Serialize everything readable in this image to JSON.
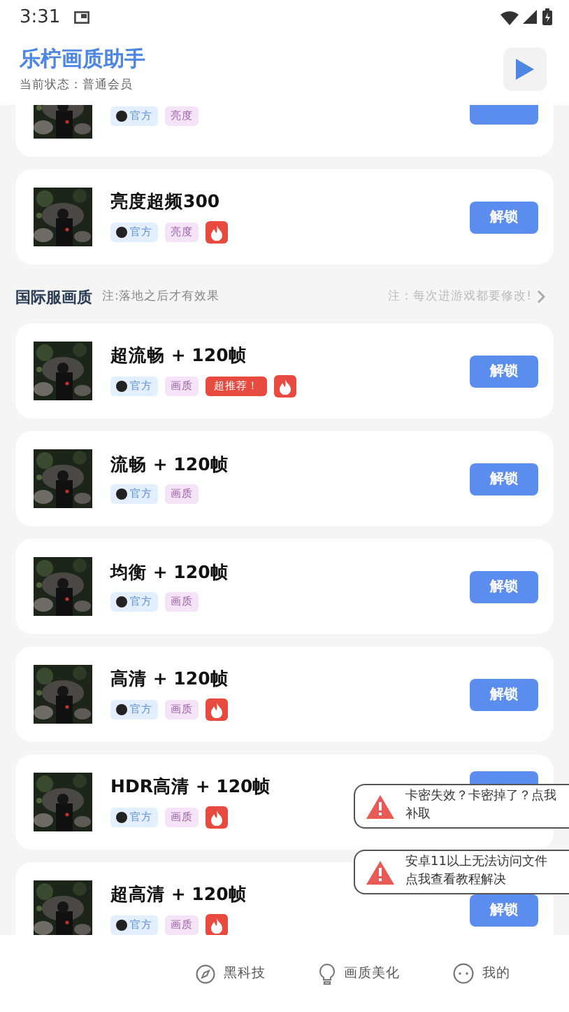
{
  "status_bar": {
    "time": "3:31"
  },
  "header": {
    "title": "乐柠画质助手",
    "status": "当前状态：普通会员"
  },
  "cards_top": [
    {
      "tags": [
        {
          "kind": "official",
          "text": "官方"
        },
        {
          "kind": "category",
          "text": "亮度"
        }
      ]
    },
    {
      "title": "亮度超频300",
      "button": "解锁",
      "tags": [
        {
          "kind": "official",
          "text": "官方"
        },
        {
          "kind": "category",
          "text": "亮度"
        },
        {
          "kind": "hot"
        }
      ]
    }
  ],
  "section": {
    "title": "国际服画质",
    "note": "注:落地之后才有效果",
    "hint": "注：每次进游戏都要修改!"
  },
  "cards": [
    {
      "title": "超流畅 + 120帧",
      "button": "解锁",
      "tags": [
        {
          "kind": "official",
          "text": "官方"
        },
        {
          "kind": "category",
          "text": "画质"
        },
        {
          "kind": "recommend",
          "text": "超推荐！"
        },
        {
          "kind": "hot"
        }
      ]
    },
    {
      "title": "流畅 + 120帧",
      "button": "解锁",
      "tags": [
        {
          "kind": "official",
          "text": "官方"
        },
        {
          "kind": "category",
          "text": "画质"
        }
      ]
    },
    {
      "title": "均衡 + 120帧",
      "button": "解锁",
      "tags": [
        {
          "kind": "official",
          "text": "官方"
        },
        {
          "kind": "category",
          "text": "画质"
        }
      ]
    },
    {
      "title": "高清 + 120帧",
      "button": "解锁",
      "tags": [
        {
          "kind": "official",
          "text": "官方"
        },
        {
          "kind": "category",
          "text": "画质"
        },
        {
          "kind": "hot"
        }
      ]
    },
    {
      "title": "HDR高清 + 120帧",
      "tags": [
        {
          "kind": "official",
          "text": "官方"
        },
        {
          "kind": "category",
          "text": "画质"
        },
        {
          "kind": "hot"
        }
      ]
    },
    {
      "title": "超高清 + 120帧",
      "button": "解锁",
      "tags": [
        {
          "kind": "official",
          "text": "官方"
        },
        {
          "kind": "category",
          "text": "画质"
        },
        {
          "kind": "hot"
        }
      ]
    }
  ],
  "toasts": [
    {
      "text": "卡密失效？卡密掉了？点我补取"
    },
    {
      "text": "安卓11以上无法访问文件点我查看教程解决"
    }
  ],
  "bottom_nav": [
    {
      "label": "黑科技",
      "kind": "compass"
    },
    {
      "label": "画质美化",
      "kind": "bulb"
    },
    {
      "label": "我的",
      "kind": "face"
    }
  ]
}
